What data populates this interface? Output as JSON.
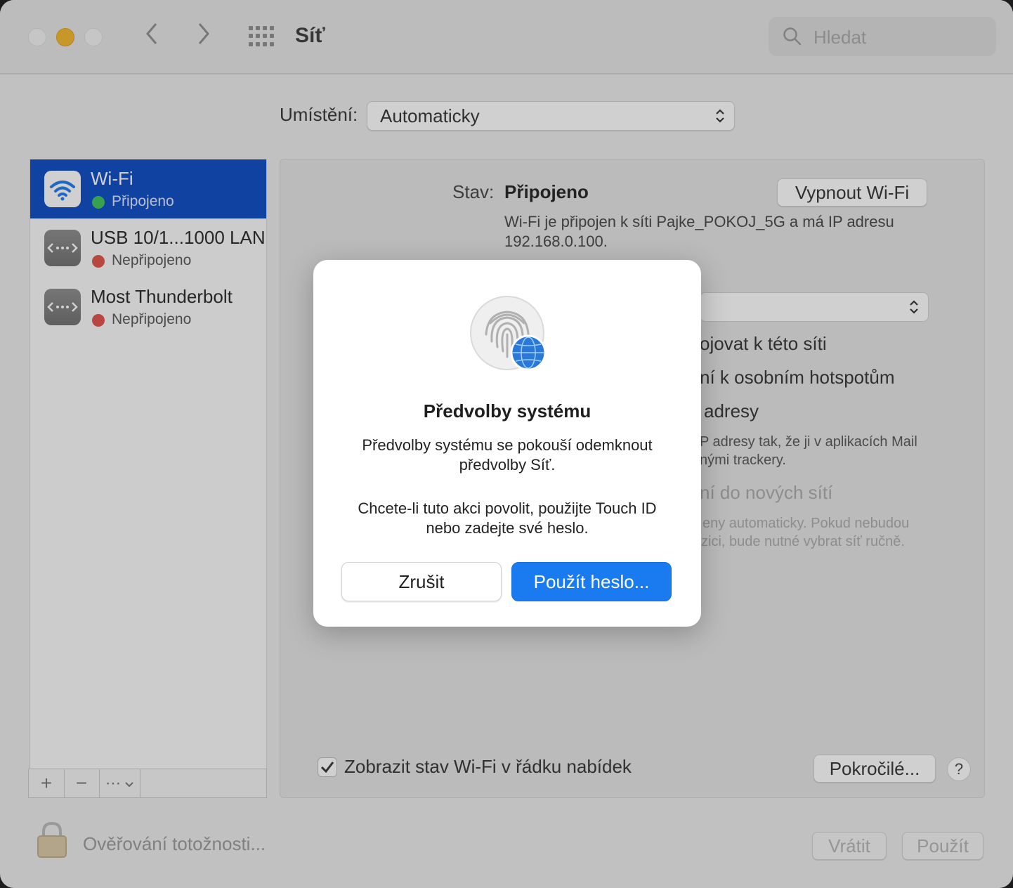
{
  "window": {
    "title": "Síť",
    "search_placeholder": "Hledat",
    "nav_back": "‹",
    "nav_forward": "›"
  },
  "location": {
    "label": "Umístění:",
    "value": "Automaticky"
  },
  "services": [
    {
      "name": "Wi-Fi",
      "status": "Připojeno",
      "status_color": "#3dc35a",
      "selected": true,
      "icon": "wifi-icon"
    },
    {
      "name": "USB 10/1...1000 LAN",
      "status": "Nepřipojeno",
      "status_color": "#e0504a",
      "selected": false,
      "icon": "ethernet-icon"
    },
    {
      "name": "Most Thunderbolt",
      "status": "Nepřipojeno",
      "status_color": "#e0504a",
      "selected": false,
      "icon": "ethernet-icon"
    }
  ],
  "sidebar_tools": {
    "add": "+",
    "remove": "−",
    "more": "⋯"
  },
  "detail": {
    "status_label": "Stav:",
    "status_value": "Připojeno",
    "toggle_button": "Vypnout Wi-Fi",
    "info_line1": "Wi-Fi je připojen k síti Pajke_POKOJ_5G a má IP adresu",
    "info_line2": "192.168.0.100.",
    "frag_auto_join": "ojovat k této síti",
    "frag_hotspot": "ní k osobním hotspotům",
    "frag_private": "adresy",
    "frag_private_desc1": "P adresy tak, že ji v aplikacích Mail",
    "frag_private_desc2": "nými trackery.",
    "frag_ask_new": "ní do nových sítí",
    "frag_ask_desc1": "eny automaticky. Pokud nebudou",
    "frag_ask_desc2": "zici, bude nutné vybrat síť ručně.",
    "show_status_label": "Zobrazit stav Wi-Fi v řádku nabídek",
    "show_status_checked": true,
    "advanced_button": "Pokročilé...",
    "help_button": "?"
  },
  "footer": {
    "auth_text": "Ověřování totožnosti...",
    "revert_button": "Vrátit",
    "apply_button": "Použít"
  },
  "dialog": {
    "title": "Předvolby systému",
    "message1_line1": "Předvolby systému se pokouší odemknout",
    "message1_line2": "předvolby Síť.",
    "message2_line1": "Chcete-li tuto akci povolit, použijte Touch ID",
    "message2_line2": "nebo zadejte své heslo.",
    "cancel_button": "Zrušit",
    "confirm_button": "Použít heslo...",
    "accent_color": "#1a7bf0"
  }
}
